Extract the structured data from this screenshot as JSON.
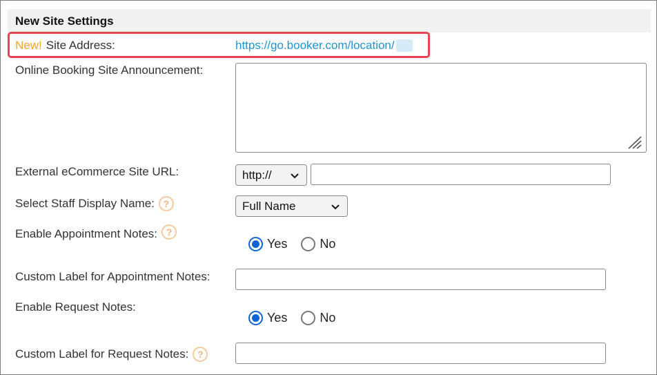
{
  "section": {
    "title": "New Site Settings"
  },
  "site_address": {
    "new_tag": "New!",
    "label": "Site Address:",
    "url": "https://go.booker.com/location/"
  },
  "announcement": {
    "label": "Online Booking Site Announcement:",
    "value": ""
  },
  "ecommerce": {
    "label": "External eCommerce Site URL:",
    "protocol": "http://",
    "url_value": ""
  },
  "staff_display": {
    "label": "Select Staff Display Name:",
    "selected": "Full Name"
  },
  "appointment_notes": {
    "label": "Enable Appointment Notes:",
    "yes": "Yes",
    "no": "No",
    "selected": "Yes"
  },
  "custom_appointment_label": {
    "label": "Custom Label for Appointment Notes:",
    "value": ""
  },
  "request_notes": {
    "label": "Enable Request Notes:",
    "yes": "Yes",
    "no": "No",
    "selected": "Yes"
  },
  "custom_request_label": {
    "label": "Custom Label for Request Notes:",
    "value": ""
  },
  "help_glyph": "?",
  "colors": {
    "accent_new": "#f2a22b",
    "link": "#1a95d8",
    "highlight": "#e6454f",
    "radio_checked": "#0f62d6"
  }
}
